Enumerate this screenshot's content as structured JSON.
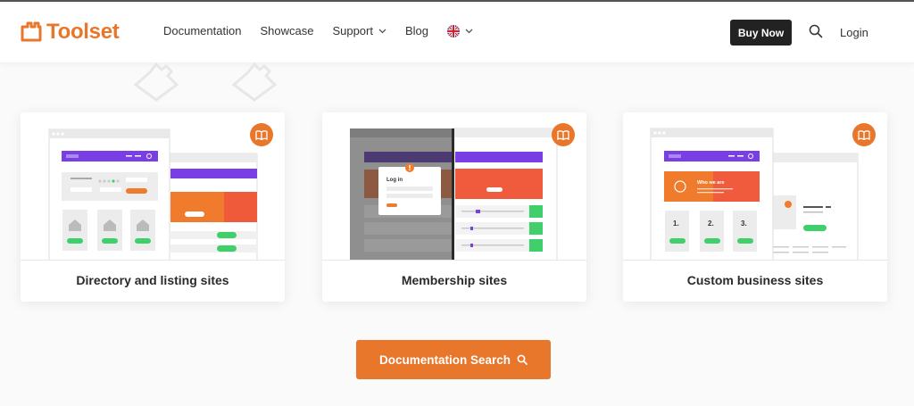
{
  "brand": {
    "name": "Toolset",
    "accent": "#e8762b"
  },
  "nav": {
    "items": [
      "Documentation",
      "Showcase",
      "Support",
      "Blog"
    ],
    "language_icon": "uk-flag-icon"
  },
  "header": {
    "buy_label": "Buy Now",
    "login_label": "Login"
  },
  "cards": [
    {
      "title": "Directory and listing sites"
    },
    {
      "title": "Membership sites",
      "mock_login": "Log in"
    },
    {
      "title": "Custom business sites",
      "mock_who": "Who we are",
      "steps": [
        "1.",
        "2.",
        "3."
      ]
    }
  ],
  "doc_search": {
    "label": "Documentation Search"
  },
  "colors": {
    "purple": "#7a3fe4",
    "green": "#3fd06b",
    "orange": "#e8762b",
    "red": "#f2493c",
    "dark": "#222222"
  }
}
